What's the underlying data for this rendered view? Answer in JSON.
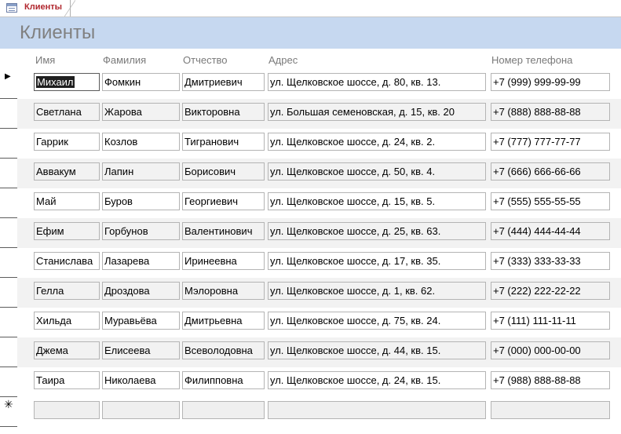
{
  "tab": {
    "label": "Клиенты",
    "icon": "form-icon"
  },
  "form": {
    "title": "Клиенты"
  },
  "columns": {
    "first_name": "Имя",
    "last_name": "Фамилия",
    "patronymic": "Отчество",
    "address": "Адрес",
    "phone": "Номер телефона"
  },
  "records": [
    {
      "first_name": "Михаил",
      "last_name": "Фомкин",
      "patronymic": "Дмитриевич",
      "address": "ул. Щелковское шоссе, д. 80, кв. 13.",
      "phone": "+7 (999) 999-99-99"
    },
    {
      "first_name": "Светлана",
      "last_name": "Жарова",
      "patronymic": "Викторовна",
      "address": "ул. Большая семеновская, д. 15, кв. 20",
      "phone": "+7 (888) 888-88-88"
    },
    {
      "first_name": "Гаррик",
      "last_name": "Козлов",
      "patronymic": "Тигранович",
      "address": "ул. Щелковское шоссе, д. 24, кв. 2.",
      "phone": "+7 (777) 777-77-77"
    },
    {
      "first_name": "Аввакум",
      "last_name": "Лапин",
      "patronymic": "Борисович",
      "address": "ул. Щелковское шоссе, д. 50, кв. 4.",
      "phone": "+7 (666) 666-66-66"
    },
    {
      "first_name": "Май",
      "last_name": "Буров",
      "patronymic": "Георгиевич",
      "address": "ул. Щелковское шоссе, д. 15, кв. 5.",
      "phone": "+7 (555) 555-55-55"
    },
    {
      "first_name": "Ефим",
      "last_name": "Горбунов",
      "patronymic": "Валентинович",
      "address": "ул. Щелковское шоссе, д. 25, кв. 63.",
      "phone": "+7 (444) 444-44-44"
    },
    {
      "first_name": "Станислава",
      "last_name": "Лазарева",
      "patronymic": "Иринеевна",
      "address": "ул. Щелковское шоссе, д. 17, кв. 35.",
      "phone": "+7 (333) 333-33-33"
    },
    {
      "first_name": "Гелла",
      "last_name": "Дроздова",
      "patronymic": "Мэлоровна",
      "address": "ул. Щелковское шоссе, д. 1, кв. 62.",
      "phone": "+7 (222) 222-22-22"
    },
    {
      "first_name": "Хильда",
      "last_name": "Муравьёва",
      "patronymic": "Дмитрьевна",
      "address": "ул. Щелковское шоссе, д. 75, кв. 24.",
      "phone": "+7 (111) 111-11-11"
    },
    {
      "first_name": "Джема",
      "last_name": "Елисеева",
      "patronymic": "Всеволодовна",
      "address": "ул. Щелковское шоссе, д. 44, кв. 15.",
      "phone": "+7 (000) 000-00-00"
    },
    {
      "first_name": "Таира",
      "last_name": "Николаева",
      "patronymic": "Филипповна",
      "address": "ул. Щелковское шоссе, д. 24, кв. 15.",
      "phone": "+7 (988) 888-88-88"
    }
  ],
  "new_record": {
    "first_name": "",
    "last_name": "",
    "patronymic": "",
    "address": "",
    "phone": ""
  },
  "selector_icons": {
    "current": "current-record-arrow-icon",
    "new": "new-record-star-icon"
  },
  "colors": {
    "header_band": "#c6d8f0",
    "tab_label": "#b0262d",
    "alt_row": "#f2f2f2"
  }
}
